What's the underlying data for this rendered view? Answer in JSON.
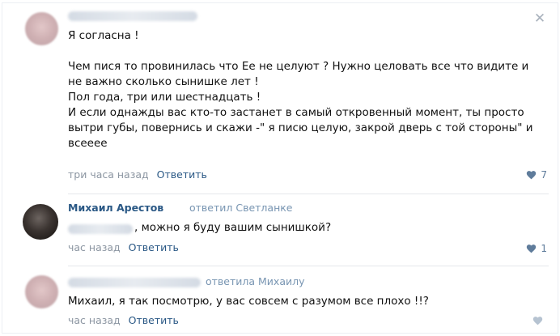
{
  "comments": [
    {
      "text": "Я согласна !\n\nЧем пися то провинилась что Ее не целуют ? Нужно целовать все что видите и не важно сколько сынишке лет !\nПол года, три или шестнадцать !\nИ если однажды вас кто-то застанет в самый откровенный момент, ты просто вытри губы, повернись и скажи -\" я писю целую, закрой дверь с той стороны\" и всееее",
      "time": "три часа назад",
      "reply_label": "Ответить",
      "likes": "7"
    },
    {
      "author": "Михаил Арестов",
      "reply_to": "ответил Светланке",
      "text": ", можно я буду вашим сынишкой?",
      "time": "час назад",
      "reply_label": "Ответить",
      "likes": "1"
    },
    {
      "reply_to": "ответила Михаилу",
      "text": "Михаил, я так посмотрю, у вас совсем с разумом все плохо !!?",
      "time": "час назад",
      "reply_label": "Ответить",
      "likes": ""
    }
  ],
  "icons": {
    "close": "close-icon",
    "like": "heart-icon"
  },
  "colors": {
    "link": "#2a5885",
    "muted": "#8c96a2",
    "like": "#5f7c9b"
  }
}
